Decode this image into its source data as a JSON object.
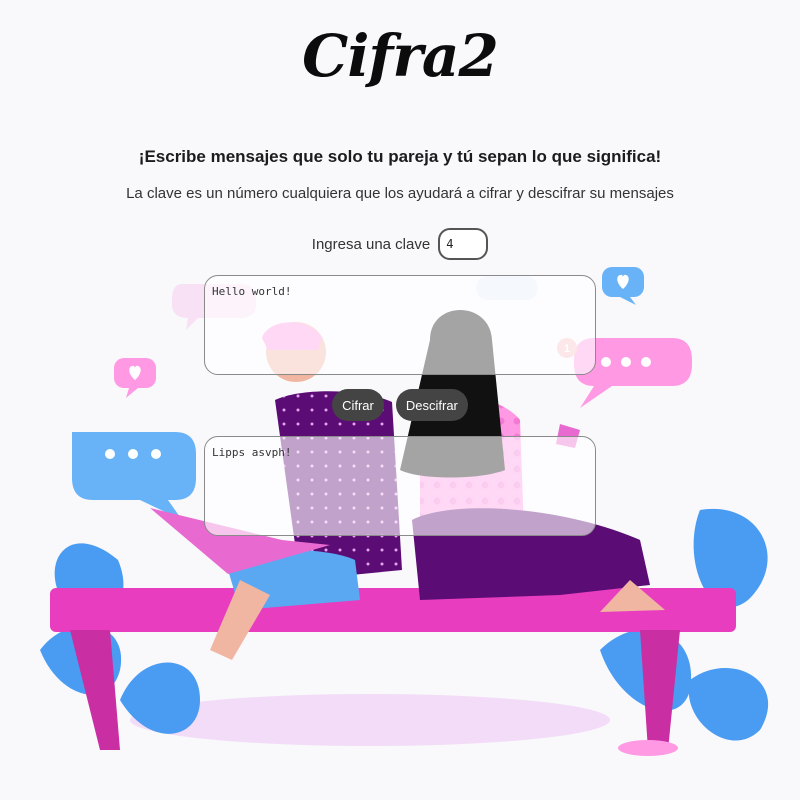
{
  "app": {
    "logo_text": "Cifra2"
  },
  "header": {
    "headline": "¡Escribe mensajes que solo tu pareja y tú sepan lo que significa!",
    "subtitle": "La clave es un número cualquiera que los ayudará a cifrar y descifrar su mensajes"
  },
  "key": {
    "label": "Ingresa una clave",
    "value": "4"
  },
  "input": {
    "value": "Hello world!"
  },
  "actions": {
    "encrypt_label": "Cifrar",
    "decrypt_label": "Descifrar"
  },
  "output": {
    "value": "Lipps asvph!"
  },
  "illustration": {
    "notification_count": "1"
  },
  "colors": {
    "bench": "#e83dbf",
    "leaves": "#4a9bf2",
    "bubble_blue": "#68b3f7",
    "bubble_pink": "#ff99e4",
    "button_bg": "#444444"
  }
}
